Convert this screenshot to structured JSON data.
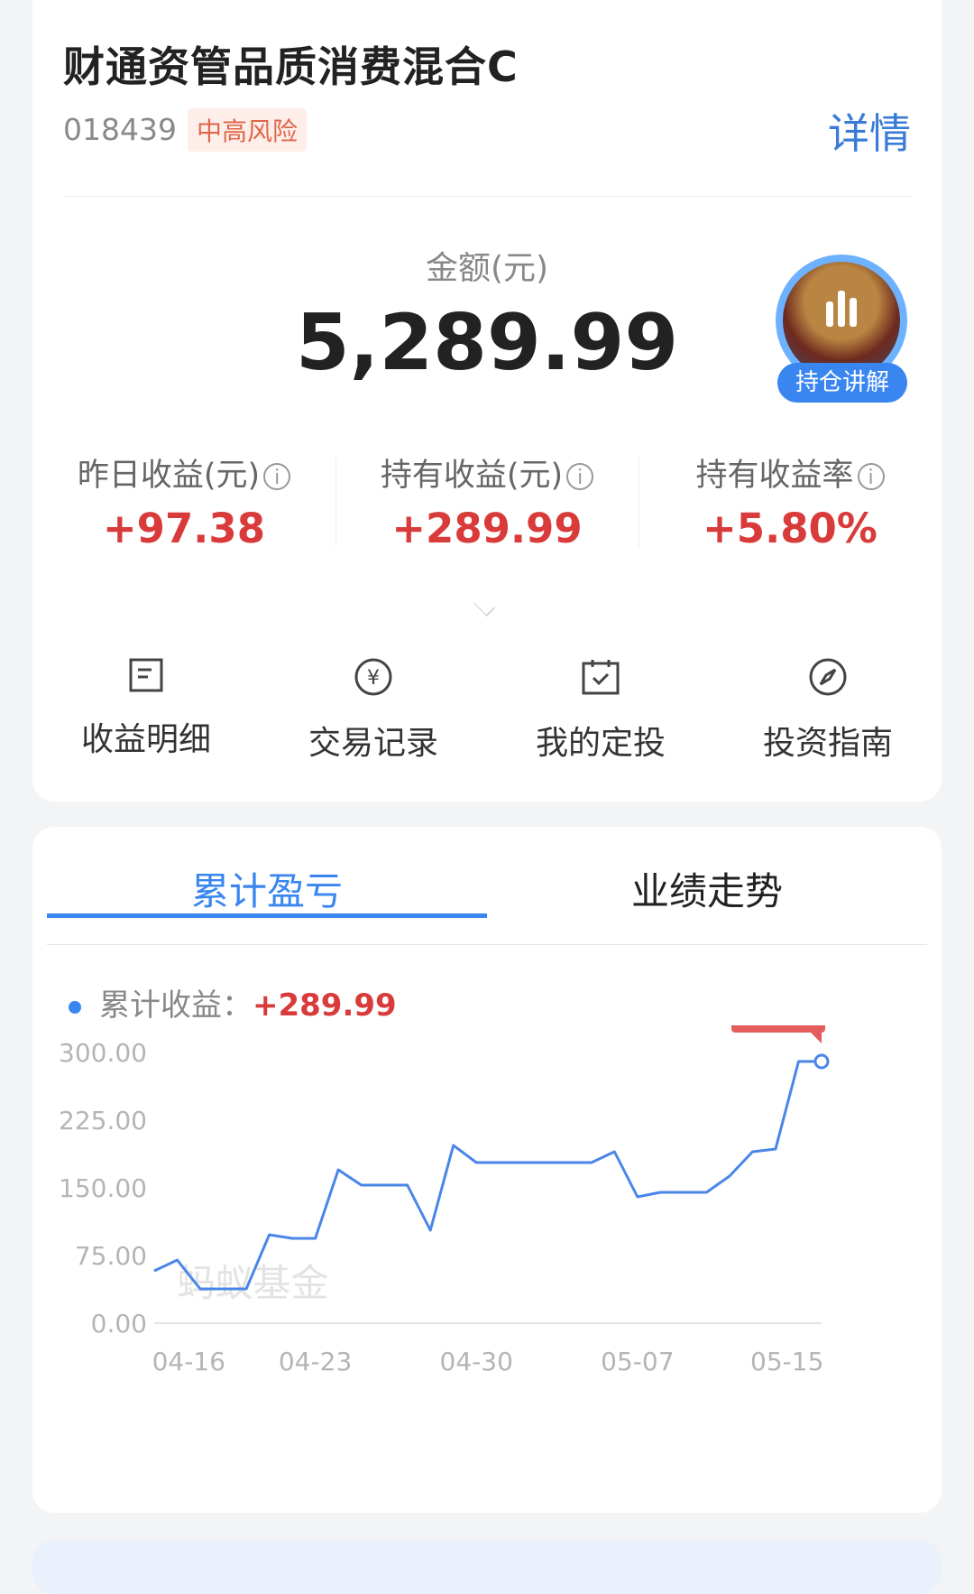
{
  "fund": {
    "title": "财通资管品质消费混合C",
    "code": "018439",
    "risk": "中高风险",
    "detail": "详情"
  },
  "amount": {
    "label": "金额(元)",
    "value": "5,289.99"
  },
  "explain": {
    "label": "持仓讲解"
  },
  "stats": [
    {
      "label": "昨日收益(元)",
      "value": "+97.38"
    },
    {
      "label": "持有收益(元)",
      "value": "+289.99"
    },
    {
      "label": "持有收益率",
      "value": "+5.80%"
    }
  ],
  "actions": [
    {
      "label": "收益明细",
      "icon": "document-icon"
    },
    {
      "label": "交易记录",
      "icon": "yuan-circle-icon"
    },
    {
      "label": "我的定投",
      "icon": "calendar-check-icon"
    },
    {
      "label": "投资指南",
      "icon": "compass-icon"
    }
  ],
  "tabs": [
    {
      "label": "累计盈亏",
      "active": true
    },
    {
      "label": "业绩走势",
      "active": false
    }
  ],
  "legend": {
    "label": "累计收益：",
    "value": "+289.99"
  },
  "chart_data": {
    "type": "line",
    "watermark": "蚂蚁基金",
    "yticks": [
      "300.00",
      "225.00",
      "150.00",
      "75.00",
      "0.00"
    ],
    "xticks": [
      "04-16",
      "04-23",
      "04-30",
      "05-07",
      "05-15"
    ],
    "ylim": [
      0,
      300
    ],
    "xlim": [
      0,
      29
    ],
    "xtick_positions": [
      1.5,
      7,
      14,
      21,
      27.5
    ],
    "end_label": "289.99",
    "series": [
      {
        "color": "#4a86e8",
        "x": [
          0,
          1,
          2,
          3,
          4,
          5,
          6,
          7,
          8,
          9,
          10,
          11,
          12,
          13,
          14,
          15,
          16,
          17,
          18,
          19,
          20,
          21,
          22,
          23,
          24,
          25,
          26,
          27,
          28,
          29
        ],
        "values": [
          58,
          70,
          38,
          38,
          38,
          98,
          94,
          94,
          170,
          153,
          153,
          153,
          103,
          197,
          178,
          178,
          178,
          178,
          178,
          178,
          190,
          140,
          145,
          145,
          145,
          163,
          190,
          193,
          290,
          290
        ]
      }
    ]
  }
}
